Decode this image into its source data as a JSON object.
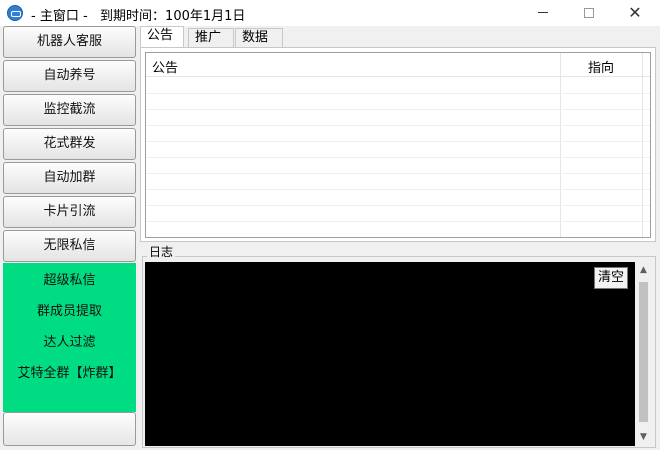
{
  "window": {
    "title": "- 主窗口 -   到期时间：100年1月1日",
    "minimize_icon": "minimize-icon",
    "maximize_icon": "maximize-icon",
    "close_glyph": "✕"
  },
  "menu": {
    "buttons": [
      "机器人客服",
      "自动养号",
      "监控截流",
      "花式群发",
      "自动加群",
      "卡片引流",
      "无限私信"
    ],
    "green_items": [
      "超级私信",
      "群成员提取",
      "达人过滤",
      "艾特全群【炸群】"
    ],
    "green_color": "#00dc82"
  },
  "tabs": [
    "公告",
    "推广",
    "数据"
  ],
  "table": {
    "columns": [
      "公告",
      "指向"
    ]
  },
  "log": {
    "label": "日志",
    "clear_button": "清空",
    "scroll_up": "▲",
    "scroll_down": "▼"
  }
}
